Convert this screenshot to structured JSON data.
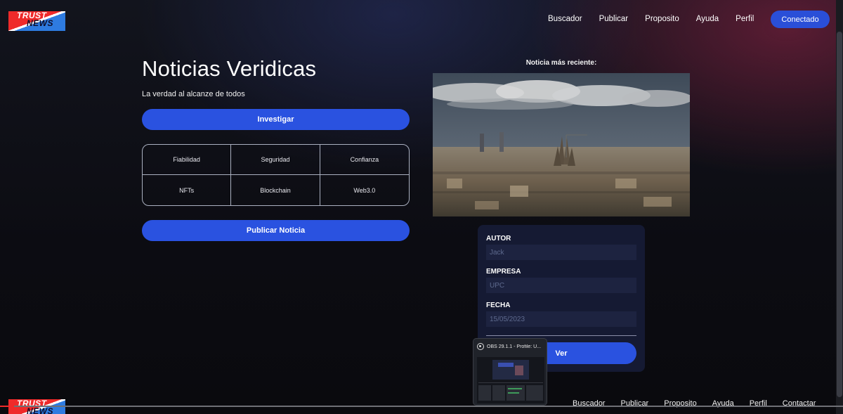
{
  "header": {
    "logo_top": "TRUST",
    "logo_bottom": "NEWS",
    "nav": [
      "Buscador",
      "Publicar",
      "Proposito",
      "Ayuda",
      "Perfil"
    ],
    "connect_button": "Conectado"
  },
  "hero": {
    "title": "Noticias Veridicas",
    "tagline": "La verdad al alcanze de todos",
    "investigate_button": "Investigar",
    "features": [
      "Fiabilidad",
      "Seguridad",
      "Confianza",
      "NFTs",
      "Blockchain",
      "Web3.0"
    ],
    "publish_button": "Publicar Noticia"
  },
  "latest": {
    "label": "Noticia más reciente:",
    "fields": [
      {
        "label": "AUTOR",
        "value": "Jack"
      },
      {
        "label": "EMPRESA",
        "value": "UPC"
      },
      {
        "label": "FECHA",
        "value": "15/05/2023"
      }
    ],
    "view_button": "Ver"
  },
  "obs_popup": {
    "title": "OBS 29.1.1 - Profile: U..."
  },
  "footer": {
    "logo_top": "TRUST",
    "logo_bottom": "NEWS",
    "nav": [
      "Buscador",
      "Publicar",
      "Proposito",
      "Ayuda",
      "Perfil",
      "Contactar"
    ]
  },
  "colors": {
    "accent": "#2a52e0",
    "card_bg": "#151a33",
    "logo_red": "#ef2a2a",
    "logo_blue": "#2e7be0"
  }
}
